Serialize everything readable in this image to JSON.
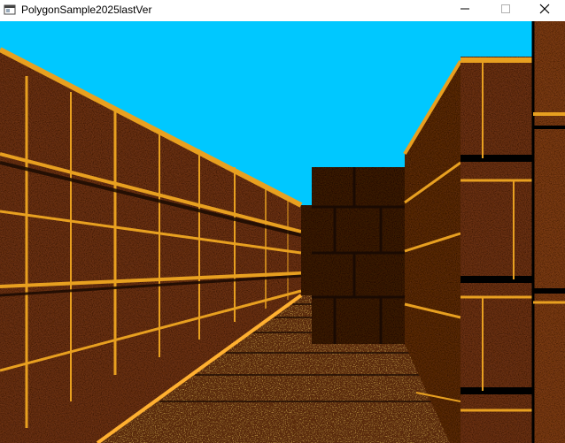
{
  "window": {
    "title": "PolygonSample2025lastVer",
    "app_icon": "window-app-icon",
    "controls": {
      "minimize_icon": "minimize-icon",
      "maximize_icon": "maximize-icon",
      "close_icon": "close-icon"
    }
  },
  "scene": {
    "description_icon": "3d-dungeon-corridor",
    "colors": {
      "sky": "#00c8ff",
      "brick": "#7a3a14",
      "brick_dark": "#2a1404",
      "mortar": "#e8a020",
      "floor": "#6a3210",
      "shadow": "#000000"
    }
  }
}
